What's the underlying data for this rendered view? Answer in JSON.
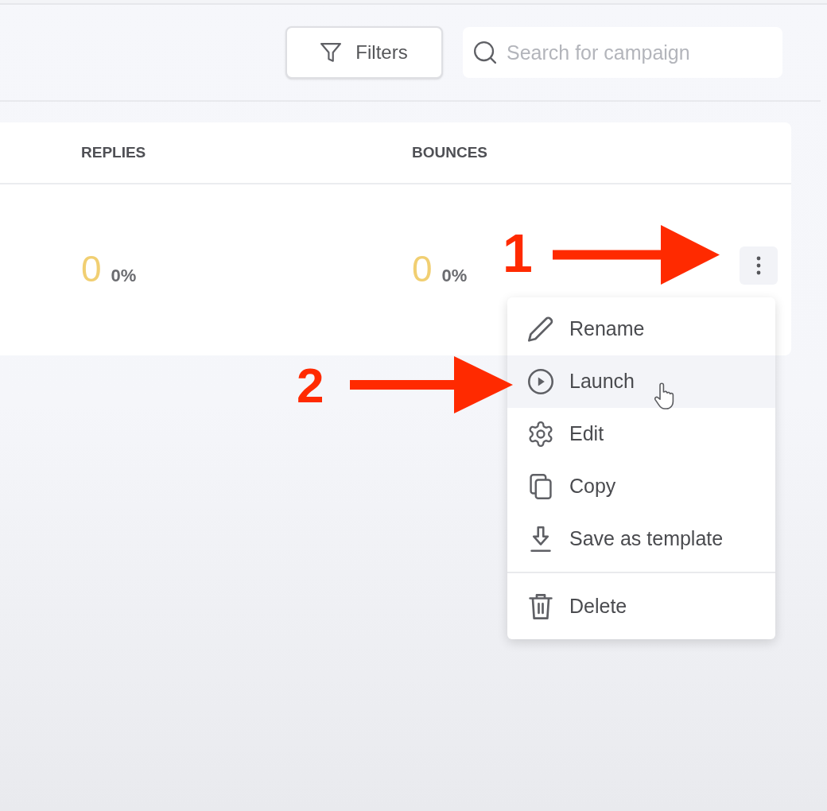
{
  "toolbar": {
    "filters_button": {
      "label": "Filters"
    },
    "search": {
      "placeholder": "Search for campaign"
    }
  },
  "table": {
    "columns": [
      "REPLIES",
      "BOUNCES"
    ],
    "rows": [
      {
        "cells": [
          {
            "count": "0",
            "percent": "0%"
          },
          {
            "count": "0",
            "percent": "0%"
          }
        ]
      }
    ]
  },
  "row_menu": {
    "sections": [
      {
        "items": [
          {
            "kind": "rename",
            "label": "Rename",
            "selected": false
          },
          {
            "kind": "launch",
            "label": "Launch",
            "selected": true
          },
          {
            "kind": "edit",
            "label": "Edit",
            "selected": false
          },
          {
            "kind": "copy",
            "label": "Copy",
            "selected": false
          },
          {
            "kind": "save_template",
            "label": "Save as template",
            "selected": false
          }
        ]
      },
      {
        "items": [
          {
            "kind": "delete",
            "label": "Delete",
            "selected": false
          }
        ]
      }
    ]
  },
  "annotations": [
    {
      "label": "1"
    },
    {
      "label": "2"
    }
  ]
}
